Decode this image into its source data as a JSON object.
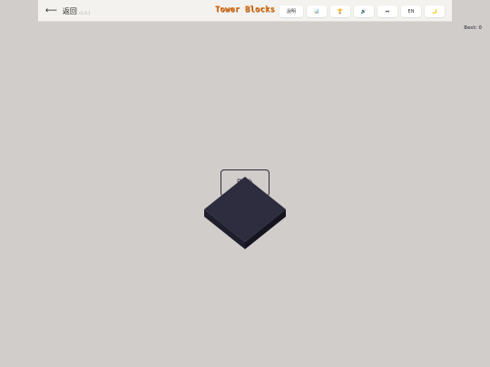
{
  "header": {
    "back_label": "返回",
    "version": "v1.0.1",
    "title": "Tower Blocks",
    "buttons": [
      {
        "label": "說明",
        "icon": "help-text",
        "name": "instructions-button"
      },
      {
        "label": "📊",
        "icon": "chart-icon",
        "name": "stats-button"
      },
      {
        "label": "🏆",
        "icon": "trophy-icon",
        "name": "leaderboard-button"
      },
      {
        "label": "🔊",
        "icon": "speaker-icon",
        "name": "sound-button"
      },
      {
        "label": "⏭",
        "icon": "skip-icon",
        "name": "skip-button"
      },
      {
        "label": "EN",
        "icon": "language-text",
        "name": "language-button"
      },
      {
        "label": "🌙",
        "icon": "moon-icon",
        "name": "theme-button"
      }
    ]
  },
  "score": {
    "best_label": "Best: 0"
  },
  "game": {
    "start_label": "開始",
    "block_colors": {
      "top": "#2e2d3f",
      "left": "#1f1e2c",
      "right": "#151420"
    },
    "background": "#d1cdca"
  }
}
